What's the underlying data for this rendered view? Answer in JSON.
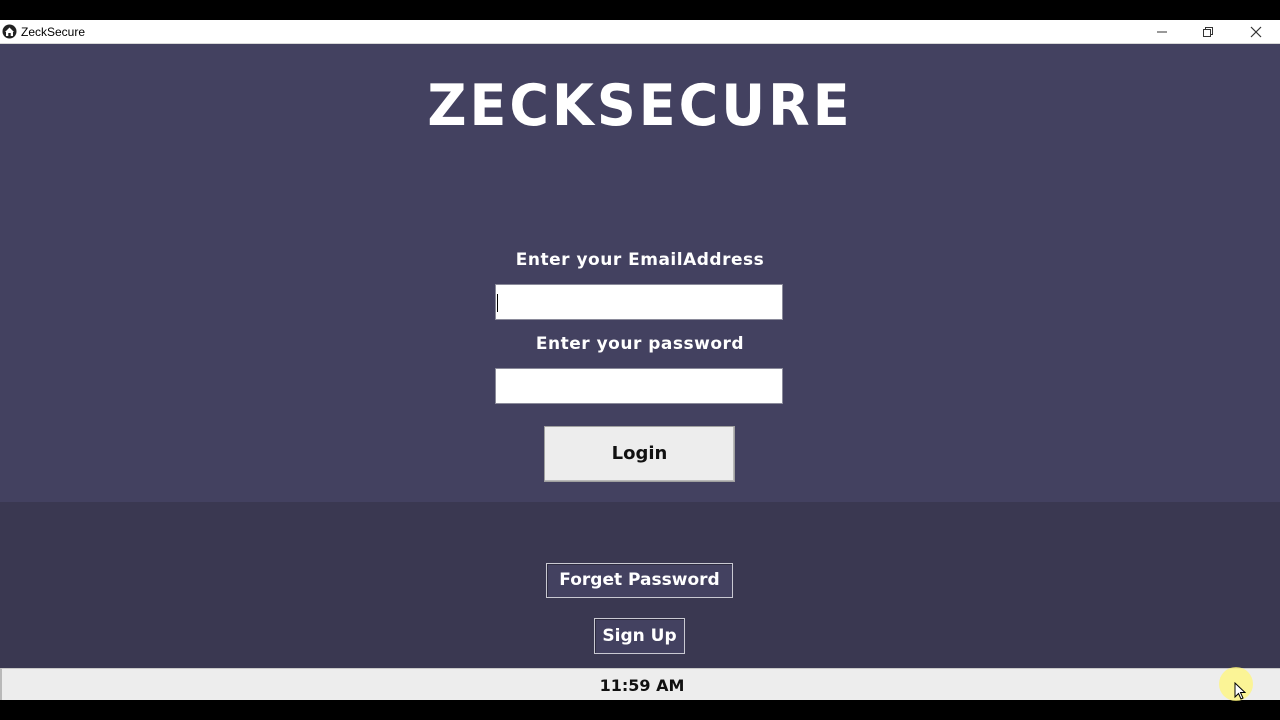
{
  "window": {
    "title": "ZeckSecure",
    "icon": "house-icon",
    "controls": [
      "minimize-icon",
      "restore-icon",
      "close-icon"
    ]
  },
  "login": {
    "brand": "ZECKSECURE",
    "email_label": "Enter your EmailAddress",
    "email_value": "",
    "password_label": "Enter your password",
    "password_value": "",
    "login_button": "Login"
  },
  "links": {
    "forget_password": "Forget Password",
    "sign_up": "Sign Up"
  },
  "status": {
    "time": "11:59 AM"
  },
  "colors": {
    "background": "#434160",
    "lower_panel": "#3a3851",
    "button_face": "#ededed"
  }
}
